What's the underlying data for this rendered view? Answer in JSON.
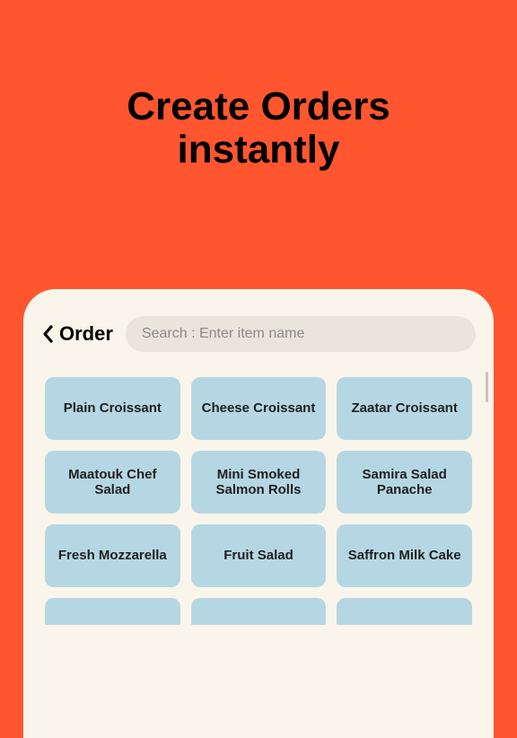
{
  "hero": {
    "line1": "Create Orders",
    "line2": "instantly"
  },
  "header": {
    "title": "Order"
  },
  "search": {
    "placeholder": "Search : Enter item name"
  },
  "items": [
    "Plain Croissant",
    "Cheese Croissant",
    "Zaatar Croissant",
    "Maatouk Chef Salad",
    "Mini Smoked Salmon Rolls",
    "Samira Salad Panache",
    "Fresh Mozzarella",
    "Fruit Salad",
    "Saffron Milk Cake"
  ]
}
